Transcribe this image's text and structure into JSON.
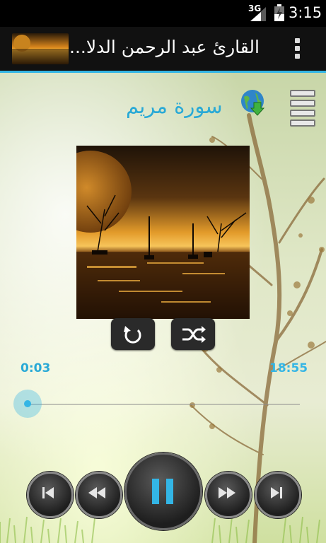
{
  "status_bar": {
    "network": "3G",
    "time": "3:15"
  },
  "action_bar": {
    "title": "القارئ عبد الرحمن الدلا...",
    "overflow_icon": "overflow-menu-icon"
  },
  "player": {
    "surah_name": "سورة مريم",
    "current_time": "0:03",
    "total_time": "18:55",
    "progress_fraction": 0.003,
    "accent_color": "#33b5e5"
  },
  "icons": {
    "download": "globe-download-icon",
    "playlist": "playlist-menu-icon",
    "repeat": "repeat-icon",
    "shuffle": "shuffle-icon",
    "previous": "skip-previous-icon",
    "rewind": "rewind-icon",
    "pause": "pause-icon",
    "forward": "fast-forward-icon",
    "next": "skip-next-icon"
  }
}
